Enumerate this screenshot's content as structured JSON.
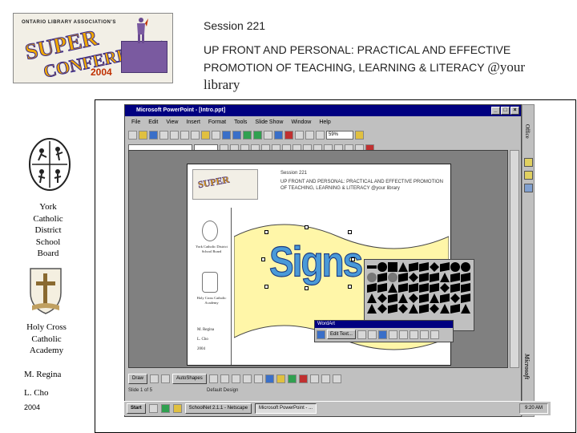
{
  "header": {
    "logo_top": "ONTARIO LIBRARY ASSOCIATION'S",
    "logo_super": "SUPER",
    "logo_conference": "CONFERENCE",
    "logo_year": "2004",
    "session": "Session 221",
    "title_line1": "UP FRONT AND PERSONAL: PRACTICAL AND EFFECTIVE",
    "title_line2": "PROMOTION OF TEACHING, LEARNING & LITERACY",
    "title_at": "@your",
    "title_line3": "library"
  },
  "left": {
    "org1": [
      "York",
      "Catholic",
      "District",
      "School",
      "Board"
    ],
    "org2": [
      "Holy Cross",
      "Catholic",
      "Academy"
    ],
    "author1": "M. Regina",
    "author2": "L. Cho",
    "year": "2004"
  },
  "app": {
    "window_title": "Microsoft PowerPoint - [Intro.ppt]",
    "menu": [
      "File",
      "Edit",
      "View",
      "Insert",
      "Format",
      "Tools",
      "Slide Show",
      "Window",
      "Help"
    ],
    "zoom": "59%",
    "office_label": "Office",
    "ms_label": "Microsoft",
    "wordart_title": "WordArt",
    "wordart_edit": "Edit Text...",
    "draw_label": "Draw",
    "autoshapes_label": "AutoShapes",
    "status_slide": "Slide 1 of 5",
    "status_design": "Default Design",
    "start": "Start",
    "task1": "SchoolNet 2.1.1 - Netscape",
    "task2": "Microsoft PowerPoint - ...",
    "clock": "9:20 AM"
  },
  "slide": {
    "session": "Session 221",
    "title": "UP FRONT AND PERSONAL: PRACTICAL AND EFFECTIVE PROMOTION OF TEACHING, LEARNING & LITERACY @your library",
    "org1": "York Catholic District School Board",
    "org2": "Holy Cross Catholic Academy",
    "author1": "M. Regina",
    "author2": "L. Cho",
    "year": "2004",
    "wordart": "Signs"
  },
  "colors": {
    "titlebar": "#000080",
    "flag": "#fff6a8",
    "wordart": "#4a9ad8"
  }
}
